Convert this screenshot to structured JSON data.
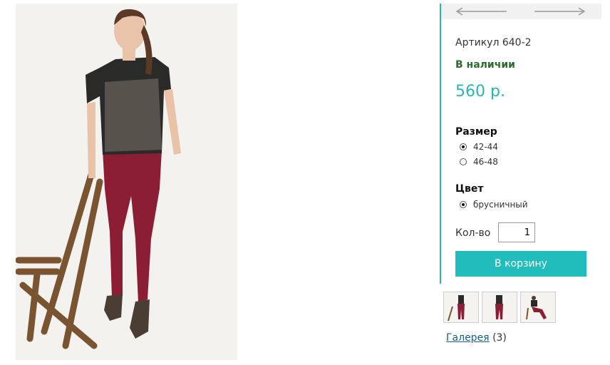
{
  "product": {
    "photo_icon": "model-photo",
    "sku": "Артикул 640-2",
    "availability": "В наличии",
    "price": "560 р."
  },
  "nav": {
    "prev_icon": "arrow-left-icon",
    "next_icon": "arrow-right-icon"
  },
  "size": {
    "title": "Размер",
    "options": [
      {
        "label": "42-44",
        "selected": true
      },
      {
        "label": "46-48",
        "selected": false
      }
    ]
  },
  "color": {
    "title": "Цвет",
    "options": [
      {
        "label": "брусничный",
        "selected": true
      }
    ]
  },
  "quantity": {
    "label": "Кол-во",
    "value": "1"
  },
  "cart": {
    "button_label": "В корзину"
  },
  "gallery": {
    "link_text": "Галерея",
    "count": "(3)"
  },
  "colors": {
    "accent": "#21bcbc",
    "stock_green": "#2e6b2e",
    "link_blue": "#1a5f8a",
    "pants": "#8b1e35"
  }
}
